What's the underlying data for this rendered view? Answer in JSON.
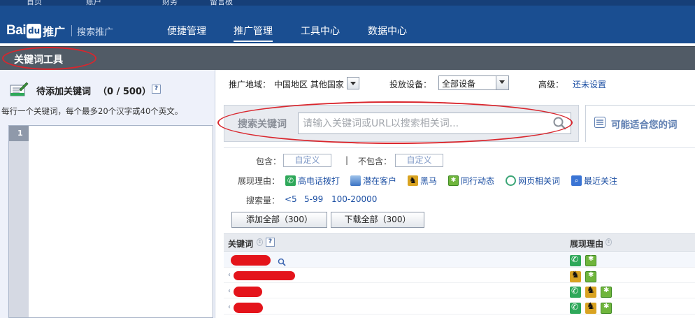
{
  "header": {
    "top_items": [
      "首页",
      "账户",
      "财务",
      "留言板"
    ],
    "logo": {
      "brand": "Bai",
      "paw": "du",
      "product": "推广",
      "subtitle": "搜索推广"
    },
    "nav": [
      {
        "label": "便捷管理",
        "active": false
      },
      {
        "label": "推广管理",
        "active": true
      },
      {
        "label": "工具中心",
        "active": false
      },
      {
        "label": "数据中心",
        "active": false
      }
    ]
  },
  "tool": {
    "title": "关键词工具"
  },
  "pending": {
    "title": "待添加关键词",
    "count": "（0 / 500）",
    "help": "?",
    "hint": "每行一个关键词，每个最多20个汉字或40个英文。",
    "line_number": "1"
  },
  "settings": {
    "region_label": "推广地域：",
    "region_value": "中国地区 其他国家",
    "device_label": "投放设备：",
    "device_value": "全部设备",
    "advanced_label": "高级：",
    "advanced_link": "还未设置"
  },
  "search": {
    "label": "搜索关键词",
    "placeholder": "请输入关键词或URL以搜索相关词..."
  },
  "suggest": {
    "label": "可能适合您的词"
  },
  "filters": {
    "include_label": "包含：",
    "include_value": "自定义",
    "exclude_sep": "|",
    "exclude_label": "不包含：",
    "exclude_value": "自定义",
    "reason_label": "展现理由：",
    "reasons": [
      {
        "label": "高电话拨打",
        "icon": "phone-icon",
        "color": "#2fa85a"
      },
      {
        "label": "潜在客户",
        "icon": "potential-customer-icon",
        "color": "#3b73c4"
      },
      {
        "label": "黑马",
        "icon": "dark-horse-icon",
        "color": "#d9a321"
      },
      {
        "label": "同行动态",
        "icon": "peer-activity-icon",
        "color": "#6fb53c"
      },
      {
        "label": "网页相关词",
        "icon": "web-related-icon",
        "color": "#3ba576"
      },
      {
        "label": "最近关注",
        "icon": "recent-focus-icon",
        "color": "#3a74d4"
      }
    ],
    "volume_label": "搜索量：",
    "volumes": [
      "<5",
      "5-99",
      "100-20000"
    ]
  },
  "actions": {
    "add_all": "添加全部（300）",
    "download_all": "下载全部（300）"
  },
  "table": {
    "col_keyword": "关键词",
    "col_reason": "展现理由",
    "help": "?",
    "rows": [
      {
        "icons": [
          "phone",
          "peer"
        ]
      },
      {
        "icons": [
          "horse",
          "peer"
        ]
      },
      {
        "icons": [
          "phone",
          "horse",
          "peer"
        ]
      },
      {
        "icons": [
          "phone",
          "horse",
          "peer"
        ]
      }
    ]
  },
  "colors": {
    "header_bg": "#1a4e91",
    "toolbar_bg": "#515b66",
    "link": "#1c4fa3",
    "annotation_red": "#d9262d"
  }
}
